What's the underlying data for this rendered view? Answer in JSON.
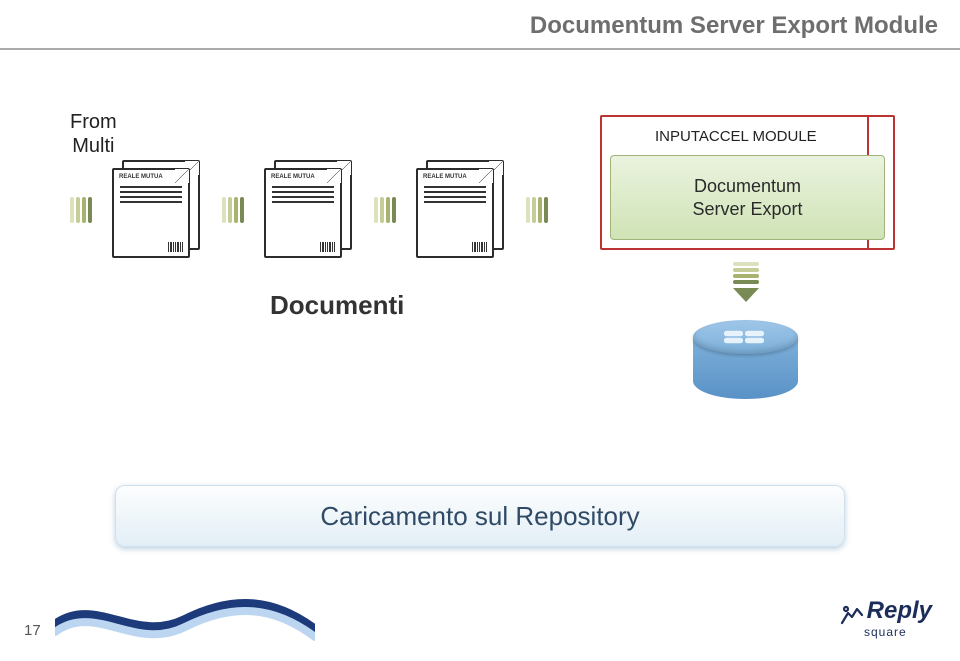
{
  "title": "Documentum Server Export Module",
  "from_multi": {
    "line1": "From",
    "line2": "Multi"
  },
  "module_label": "INPUTACCEL MODULE",
  "module_box": {
    "line1": "Documentum",
    "line2": "Server Export"
  },
  "documenti_label": "Documenti",
  "banner": "Caricamento sul Repository",
  "page_number": "17",
  "footer_brand": {
    "name": "Reply",
    "subtitle": "square"
  },
  "doc_logo": "REALE MUTUA"
}
